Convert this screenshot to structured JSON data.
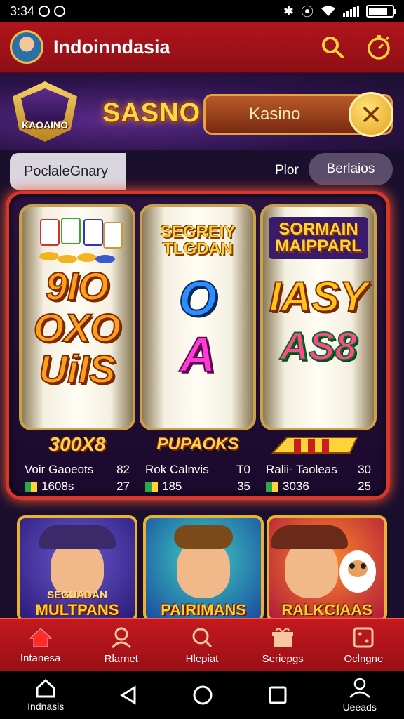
{
  "status_bar": {
    "time": "3:34"
  },
  "app_bar": {
    "title": "Indoinndasia"
  },
  "banner": {
    "crest_label": "KAOAINO",
    "brand_text": "SASNO",
    "search_value": "Kasino"
  },
  "filters": {
    "chip_label": "PoclaleGnary",
    "middle_label": "Plor",
    "pill_label": "Berlaios"
  },
  "reels": [
    {
      "header": "",
      "symbols": [
        "9IO",
        "OXO",
        "UiIS"
      ]
    },
    {
      "header": "SEGREIY TLGDAN",
      "symbols": [
        "O",
        "A"
      ]
    },
    {
      "header": "SORMAIN MAIPPARL",
      "symbols": [
        "IASY",
        "AS8"
      ]
    }
  ],
  "paytable": [
    {
      "title": "300X8",
      "row1_label": "Voir Gaoeots",
      "row1_value": "82",
      "row2_label": "1608s",
      "row2_value": "27"
    },
    {
      "title": "PUPAOKS",
      "row1_label": "Rok Calnvis",
      "row1_value": "T0",
      "row2_label": "185",
      "row2_value": "35"
    },
    {
      "title": "",
      "row1_label": "Ralii- Taoleas",
      "row1_value": "30",
      "row2_label": "3036",
      "row2_value": "25"
    }
  ],
  "game_cards": [
    {
      "sub": "SEGUADAN",
      "title": "MULTPANS"
    },
    {
      "sub": "",
      "title": "PAIRIMANS"
    },
    {
      "sub": "",
      "title": "RALKCIAAS"
    }
  ],
  "tabs": [
    {
      "label": "Intanesa",
      "icon": "home-icon"
    },
    {
      "label": "Rlarnet",
      "icon": "person-icon"
    },
    {
      "label": "Hlepiat",
      "icon": "search-icon"
    },
    {
      "label": "Seriepgs",
      "icon": "gift-icon"
    },
    {
      "label": "Oclngne",
      "icon": "dice-icon"
    }
  ],
  "system_nav": {
    "home_label": "Indnasis",
    "profile_label": "Ueeads"
  },
  "colors": {
    "primary_red": "#b3141c",
    "gold": "#e9b233",
    "background": "#1b0f2e"
  }
}
